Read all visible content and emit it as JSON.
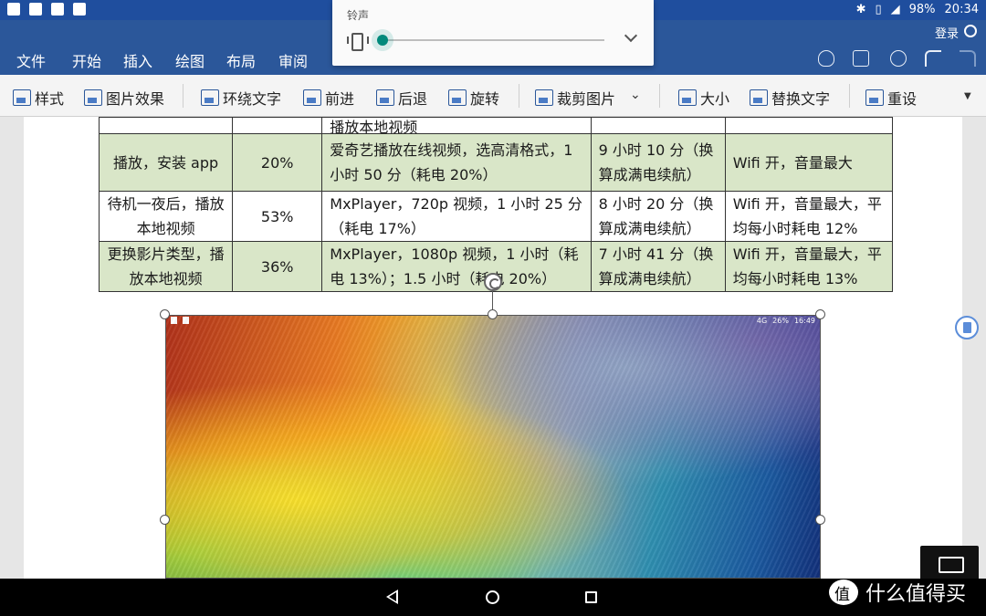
{
  "status_bar": {
    "battery": "98%",
    "time": "20:34"
  },
  "title_bar": {
    "login": "登录"
  },
  "ribbon": {
    "tabs": [
      "文件",
      "开始",
      "插入",
      "绘图",
      "布局",
      "审阅"
    ]
  },
  "toolbar": {
    "style": "样式",
    "picture_effects": "图片效果",
    "wrap_text": "环绕文字",
    "bring_forward": "前进",
    "send_backward": "后退",
    "rotate": "旋转",
    "crop": "裁剪图片",
    "size": "大小",
    "alt_text": "替换文字",
    "reset": "重设"
  },
  "volume_popup": {
    "label": "铃声",
    "level": 0.0
  },
  "table": {
    "top_fragment": "播放本地视频",
    "rows": [
      {
        "scenario": "播放，安装 app",
        "battery": "20%",
        "detail": "爱奇艺播放在线视频，选高清格式，1 小时 50 分（耗电 20%）",
        "estimate": "9 小时 10 分（换算成满电续航）",
        "settings": "Wifi 开，音量最大",
        "style": "green"
      },
      {
        "scenario": "待机一夜后，播放本地视频",
        "battery": "53%",
        "detail": "MxPlayer，720p 视频，1 小时 25 分（耗电 17%）",
        "estimate": "8 小时 20 分（换算成满电续航）",
        "settings": "Wifi 开，音量最大，平均每小时耗电 12%",
        "style": "white"
      },
      {
        "scenario": "更换影片类型，播放本地视频",
        "battery": "36%",
        "detail": "MxPlayer，1080p 视频，1 小时（耗电 13%）；1.5 小时（耗电 20%）",
        "estimate": "7 小时 41 分（换算成满电续航）",
        "settings": "Wifi 开，音量最大，平均每小时耗电 13%",
        "style": "green"
      }
    ]
  },
  "embedded_image": {
    "status_network": "4G",
    "status_battery": "26%",
    "status_time": "16:49"
  },
  "watermark": {
    "text": "什么值得买"
  }
}
